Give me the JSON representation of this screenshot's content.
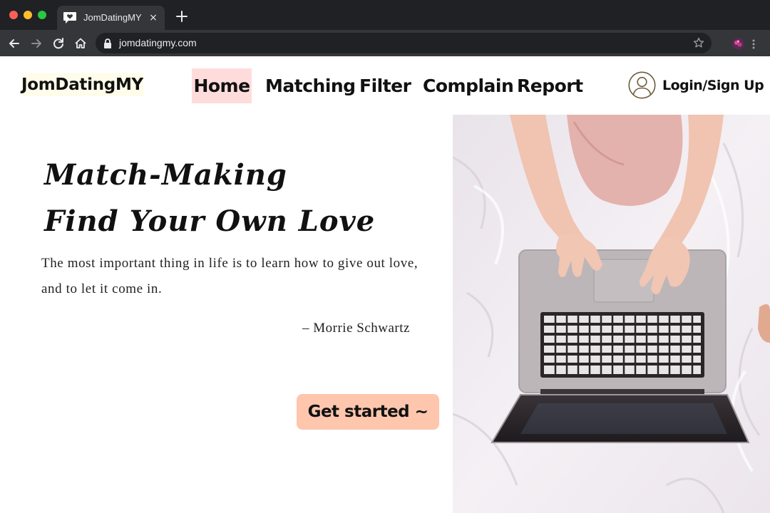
{
  "browser": {
    "tab_title": "JomDatingMY",
    "tab_close": "×",
    "url": "jomdatingmy.com",
    "icons": [
      "back-arrow-icon",
      "forward-arrow-icon",
      "reload-icon",
      "home-icon",
      "lock-icon",
      "star-icon",
      "extension-icon",
      "menu-dots-icon",
      "new-tab-plus-icon",
      "favicon-heart-icon"
    ]
  },
  "site": {
    "logo": "JomDatingMY",
    "nav": {
      "home": "Home",
      "matching": "Matching",
      "filter": "Filter",
      "complain": "Complain",
      "report": "Report"
    },
    "login": "Login/Sign Up",
    "user_icon": "user-circle-icon"
  },
  "hero": {
    "title_line1": "Match-Making",
    "title_line2": "Find Your Own Love",
    "quote": "The most important thing in life is to learn how to give out love, and to let it come in.",
    "author": "– Morrie Schwartz",
    "cta": "Get started ~"
  },
  "colors": {
    "active_nav_bg": "#ffdcdc",
    "cta_bg": "#fdc6ad",
    "logo_bg": "#fffcea",
    "chrome_dark": "#202124",
    "chrome_mid": "#35363a"
  }
}
